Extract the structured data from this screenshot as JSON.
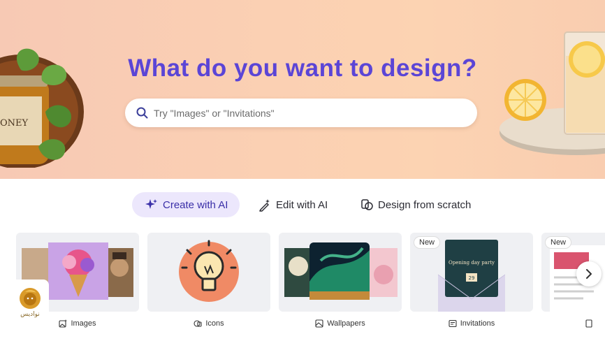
{
  "hero": {
    "title": "What do you want to design?",
    "search_placeholder": "Try \"Images\" or \"Invitations\""
  },
  "tabs": [
    {
      "label": "Create with AI",
      "icon": "sparkle-icon",
      "active": true
    },
    {
      "label": "Edit with AI",
      "icon": "magic-pen-icon",
      "active": false
    },
    {
      "label": "Design from scratch",
      "icon": "shapes-icon",
      "active": false
    }
  ],
  "cards": [
    {
      "label": "Images",
      "icon": "image-ai-icon",
      "badge": ""
    },
    {
      "label": "Icons",
      "icon": "icons-icon",
      "badge": ""
    },
    {
      "label": "Wallpapers",
      "icon": "wallpaper-icon",
      "badge": ""
    },
    {
      "label": "Invitations",
      "icon": "invitation-icon",
      "badge": "New",
      "preview_text": "Opening day party",
      "preview_date": "29"
    },
    {
      "label": "",
      "icon": "document-icon",
      "badge": "New"
    }
  ],
  "watermark": {
    "text": "نوادیس"
  },
  "colors": {
    "accent": "#5b45d6",
    "active_tab_bg": "#ece7fc",
    "hero_bg": "#fbd0b3"
  }
}
